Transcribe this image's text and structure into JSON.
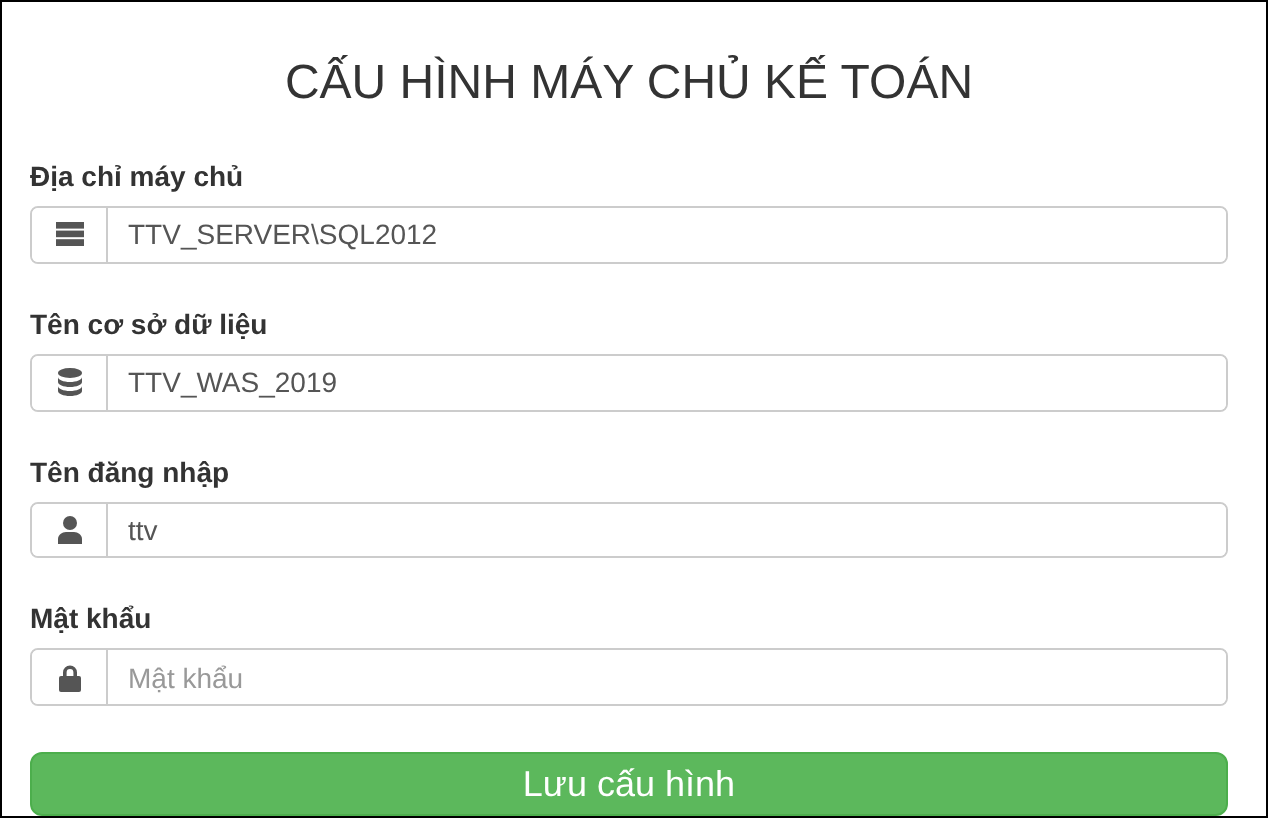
{
  "title": "CẤU HÌNH MÁY CHỦ KẾ TOÁN",
  "fields": [
    {
      "label": "Địa chỉ máy chủ",
      "kind": "server",
      "value": "TTV_SERVER\\SQL2012"
    },
    {
      "label": "Tên cơ sở dữ liệu",
      "kind": "database",
      "value": "TTV_WAS_2019"
    },
    {
      "label": "Tên đăng nhập",
      "kind": "user",
      "value": "ttv"
    },
    {
      "label": "Mật khẩu",
      "kind": "lock",
      "placeholder": "Mật khẩu"
    }
  ],
  "button": "Lưu cấu hình"
}
